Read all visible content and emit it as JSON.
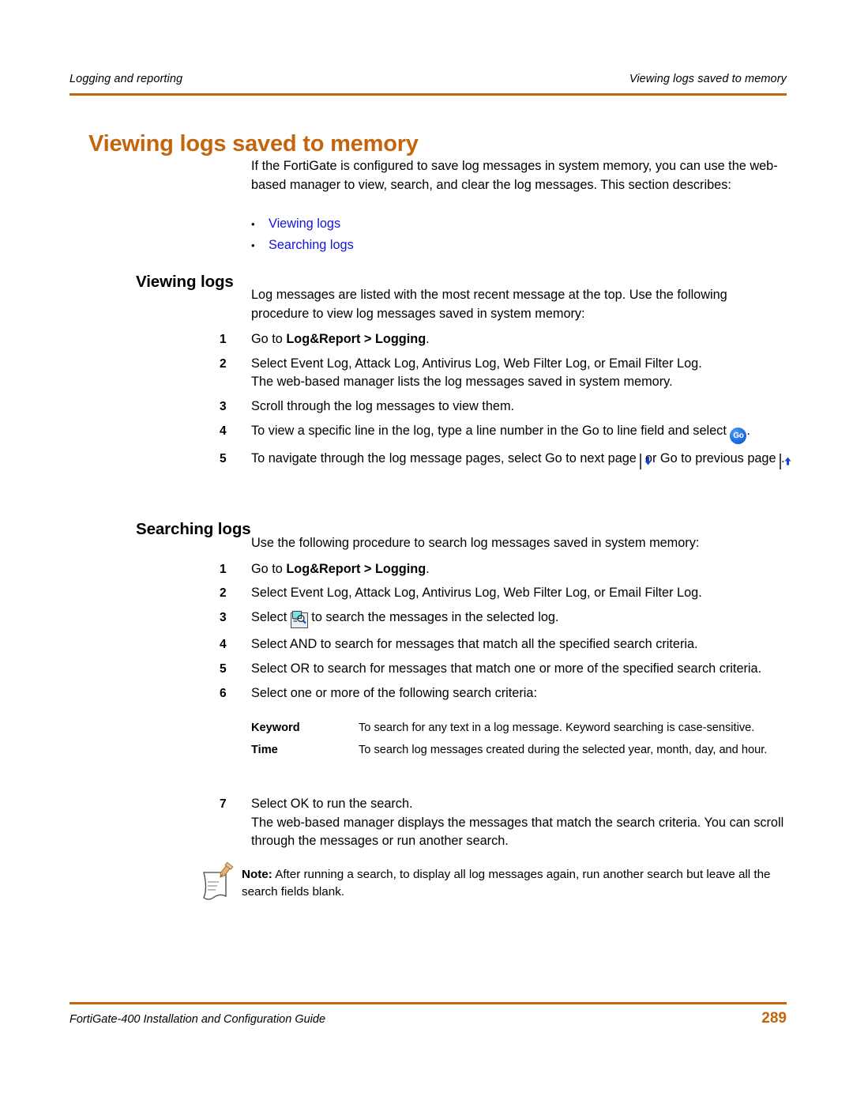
{
  "header": {
    "left": "Logging and reporting",
    "right": "Viewing logs saved to memory"
  },
  "title": "Viewing logs saved to memory",
  "intro": "If the FortiGate is configured to save log messages in system memory, you can use the web-based manager to view, search, and clear the log messages. This section describes:",
  "bullets": [
    {
      "label": "Viewing logs"
    },
    {
      "label": "Searching logs"
    }
  ],
  "sections": [
    {
      "heading": "Viewing logs",
      "lead_in": "Log messages are listed with the most recent message at the top. Use the following procedure to view log messages saved in system memory:",
      "steps": [
        {
          "num": "1",
          "pre": "Go to ",
          "bold": "Log&Report > Logging",
          "post": "."
        },
        {
          "num": "2",
          "text": "Select Event Log, Attack Log, Antivirus Log, Web Filter Log, or Email Filter Log.",
          "cont": "The web-based manager lists the log messages saved in system memory."
        },
        {
          "num": "3",
          "text": "Scroll through the log messages to view them."
        },
        {
          "num": "4",
          "pre": "To view a specific line in the log, type a line number in the Go to line field and select ",
          "icon": "go-button-icon",
          "post": "."
        },
        {
          "num": "5",
          "pre": "To navigate through the log message pages, select Go to next page ",
          "icon": "next-page-icon",
          "mid": " or Go to previous page ",
          "icon2": "previous-page-icon",
          "post": "."
        }
      ]
    },
    {
      "heading": "Searching logs",
      "lead_in": "Use the following procedure to search log messages saved in system memory:",
      "steps": [
        {
          "num": "1",
          "pre": "Go to ",
          "bold": "Log&Report > Logging",
          "post": "."
        },
        {
          "num": "2",
          "text": "Select Event Log, Attack Log, Antivirus Log, Web Filter Log, or Email Filter Log."
        },
        {
          "num": "3",
          "pre": "Select ",
          "icon": "search-log-icon",
          "post": " to search the messages in the selected log."
        },
        {
          "num": "4",
          "text": "Select AND to search for messages that match all the specified search criteria."
        },
        {
          "num": "5",
          "text": "Select OR to search for messages that match one or more of the specified search criteria."
        },
        {
          "num": "6",
          "text": "Select one or more of the following search criteria:"
        },
        {
          "num": "7",
          "text": "Select OK to run the search.",
          "cont": "The web-based manager displays the messages that match the search criteria. You can scroll through the messages or run another search."
        }
      ]
    }
  ],
  "criteria_table": {
    "rows": [
      {
        "term": "Keyword",
        "desc": "To search for any text in a log message. Keyword searching is case-sensitive."
      },
      {
        "term": "Time",
        "desc": "To search log messages created during the selected year, month, day, and hour."
      }
    ]
  },
  "note": {
    "label": "Note:",
    "text": " After running a search, to display all log messages again, run another search but leave all the search fields blank."
  },
  "footer": {
    "left": "FortiGate-400 Installation and Configuration Guide",
    "page": "289"
  },
  "colors": {
    "accent_orange": "#C4650E",
    "link_blue": "#1414D8",
    "go_button_blue": "#1d6fe0",
    "arrow_blue": "#1546c8",
    "search_glass_cyan": "#7fe3ee",
    "note_pencil_tan": "#e0b070"
  },
  "icons": {
    "go": "Go",
    "bullet": "•"
  }
}
